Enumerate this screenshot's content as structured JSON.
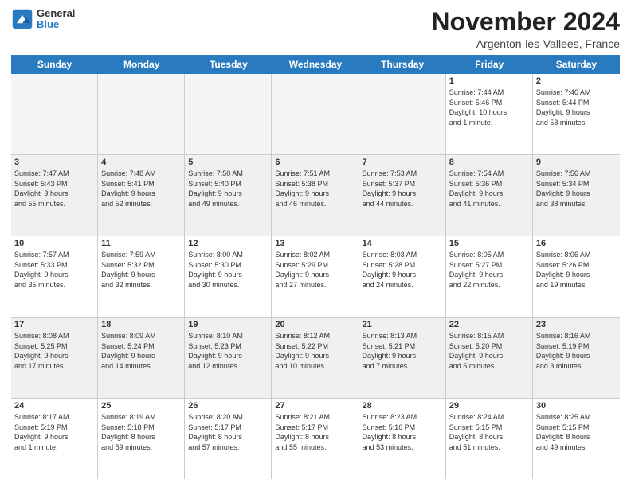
{
  "logo": {
    "line1": "General",
    "line2": "Blue"
  },
  "title": "November 2024",
  "location": "Argenton-les-Vallees, France",
  "header_days": [
    "Sunday",
    "Monday",
    "Tuesday",
    "Wednesday",
    "Thursday",
    "Friday",
    "Saturday"
  ],
  "rows": [
    [
      {
        "day": "",
        "info": "",
        "empty": true
      },
      {
        "day": "",
        "info": "",
        "empty": true
      },
      {
        "day": "",
        "info": "",
        "empty": true
      },
      {
        "day": "",
        "info": "",
        "empty": true
      },
      {
        "day": "",
        "info": "",
        "empty": true
      },
      {
        "day": "1",
        "info": "Sunrise: 7:44 AM\nSunset: 5:46 PM\nDaylight: 10 hours\nand 1 minute.",
        "empty": false
      },
      {
        "day": "2",
        "info": "Sunrise: 7:46 AM\nSunset: 5:44 PM\nDaylight: 9 hours\nand 58 minutes.",
        "empty": false
      }
    ],
    [
      {
        "day": "3",
        "info": "Sunrise: 7:47 AM\nSunset: 5:43 PM\nDaylight: 9 hours\nand 55 minutes.",
        "empty": false
      },
      {
        "day": "4",
        "info": "Sunrise: 7:48 AM\nSunset: 5:41 PM\nDaylight: 9 hours\nand 52 minutes.",
        "empty": false
      },
      {
        "day": "5",
        "info": "Sunrise: 7:50 AM\nSunset: 5:40 PM\nDaylight: 9 hours\nand 49 minutes.",
        "empty": false
      },
      {
        "day": "6",
        "info": "Sunrise: 7:51 AM\nSunset: 5:38 PM\nDaylight: 9 hours\nand 46 minutes.",
        "empty": false
      },
      {
        "day": "7",
        "info": "Sunrise: 7:53 AM\nSunset: 5:37 PM\nDaylight: 9 hours\nand 44 minutes.",
        "empty": false
      },
      {
        "day": "8",
        "info": "Sunrise: 7:54 AM\nSunset: 5:36 PM\nDaylight: 9 hours\nand 41 minutes.",
        "empty": false
      },
      {
        "day": "9",
        "info": "Sunrise: 7:56 AM\nSunset: 5:34 PM\nDaylight: 9 hours\nand 38 minutes.",
        "empty": false
      }
    ],
    [
      {
        "day": "10",
        "info": "Sunrise: 7:57 AM\nSunset: 5:33 PM\nDaylight: 9 hours\nand 35 minutes.",
        "empty": false
      },
      {
        "day": "11",
        "info": "Sunrise: 7:59 AM\nSunset: 5:32 PM\nDaylight: 9 hours\nand 32 minutes.",
        "empty": false
      },
      {
        "day": "12",
        "info": "Sunrise: 8:00 AM\nSunset: 5:30 PM\nDaylight: 9 hours\nand 30 minutes.",
        "empty": false
      },
      {
        "day": "13",
        "info": "Sunrise: 8:02 AM\nSunset: 5:29 PM\nDaylight: 9 hours\nand 27 minutes.",
        "empty": false
      },
      {
        "day": "14",
        "info": "Sunrise: 8:03 AM\nSunset: 5:28 PM\nDaylight: 9 hours\nand 24 minutes.",
        "empty": false
      },
      {
        "day": "15",
        "info": "Sunrise: 8:05 AM\nSunset: 5:27 PM\nDaylight: 9 hours\nand 22 minutes.",
        "empty": false
      },
      {
        "day": "16",
        "info": "Sunrise: 8:06 AM\nSunset: 5:26 PM\nDaylight: 9 hours\nand 19 minutes.",
        "empty": false
      }
    ],
    [
      {
        "day": "17",
        "info": "Sunrise: 8:08 AM\nSunset: 5:25 PM\nDaylight: 9 hours\nand 17 minutes.",
        "empty": false
      },
      {
        "day": "18",
        "info": "Sunrise: 8:09 AM\nSunset: 5:24 PM\nDaylight: 9 hours\nand 14 minutes.",
        "empty": false
      },
      {
        "day": "19",
        "info": "Sunrise: 8:10 AM\nSunset: 5:23 PM\nDaylight: 9 hours\nand 12 minutes.",
        "empty": false
      },
      {
        "day": "20",
        "info": "Sunrise: 8:12 AM\nSunset: 5:22 PM\nDaylight: 9 hours\nand 10 minutes.",
        "empty": false
      },
      {
        "day": "21",
        "info": "Sunrise: 8:13 AM\nSunset: 5:21 PM\nDaylight: 9 hours\nand 7 minutes.",
        "empty": false
      },
      {
        "day": "22",
        "info": "Sunrise: 8:15 AM\nSunset: 5:20 PM\nDaylight: 9 hours\nand 5 minutes.",
        "empty": false
      },
      {
        "day": "23",
        "info": "Sunrise: 8:16 AM\nSunset: 5:19 PM\nDaylight: 9 hours\nand 3 minutes.",
        "empty": false
      }
    ],
    [
      {
        "day": "24",
        "info": "Sunrise: 8:17 AM\nSunset: 5:19 PM\nDaylight: 9 hours\nand 1 minute.",
        "empty": false
      },
      {
        "day": "25",
        "info": "Sunrise: 8:19 AM\nSunset: 5:18 PM\nDaylight: 8 hours\nand 59 minutes.",
        "empty": false
      },
      {
        "day": "26",
        "info": "Sunrise: 8:20 AM\nSunset: 5:17 PM\nDaylight: 8 hours\nand 57 minutes.",
        "empty": false
      },
      {
        "day": "27",
        "info": "Sunrise: 8:21 AM\nSunset: 5:17 PM\nDaylight: 8 hours\nand 55 minutes.",
        "empty": false
      },
      {
        "day": "28",
        "info": "Sunrise: 8:23 AM\nSunset: 5:16 PM\nDaylight: 8 hours\nand 53 minutes.",
        "empty": false
      },
      {
        "day": "29",
        "info": "Sunrise: 8:24 AM\nSunset: 5:15 PM\nDaylight: 8 hours\nand 51 minutes.",
        "empty": false
      },
      {
        "day": "30",
        "info": "Sunrise: 8:25 AM\nSunset: 5:15 PM\nDaylight: 8 hours\nand 49 minutes.",
        "empty": false
      }
    ]
  ]
}
